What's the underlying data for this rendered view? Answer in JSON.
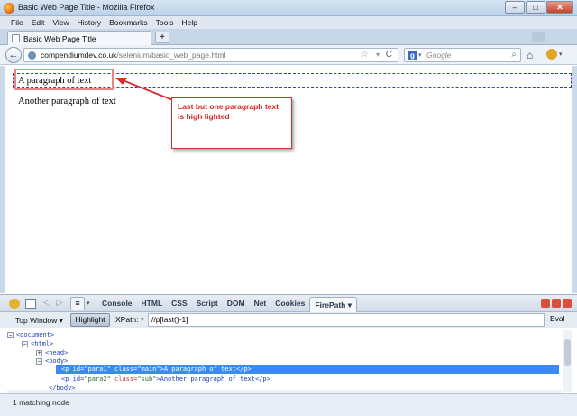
{
  "window": {
    "title": "Basic Web Page Title - Mozilla Firefox",
    "min_glyph": "–",
    "max_glyph": "□",
    "close_glyph": "✕"
  },
  "menu": [
    "File",
    "Edit",
    "View",
    "History",
    "Bookmarks",
    "Tools",
    "Help"
  ],
  "tab": {
    "label": "Basic Web Page Title",
    "new_tab_glyph": "+"
  },
  "nav": {
    "back_glyph": "←",
    "url_host": "compendiumdev.co.uk",
    "url_path": "/selenium/basic_web_page.html",
    "star_glyph": "☆",
    "drop_glyph": "▾",
    "reload_glyph": "C",
    "search_engine_glyph": "g",
    "search_placeholder": "Google",
    "search_glyph": "⌕",
    "home_glyph": "⌂"
  },
  "page": {
    "paragraph1": "A paragraph of text",
    "paragraph2": "Another paragraph of text",
    "annotation": "Last but one paragraph text is high lighted"
  },
  "firebug": {
    "menu_glyph": "≡",
    "back_glyph": "◁",
    "forward_glyph": "▷",
    "tabs": [
      "Console",
      "HTML",
      "CSS",
      "Script",
      "DOM",
      "Net",
      "Cookies",
      "FirePath ▾"
    ],
    "active_tab": "FirePath ▾",
    "top_window": "Top Window ▾",
    "highlight_label": "Highlight",
    "xpath_label": "XPath:",
    "xpath_value": "//p[last()-1]",
    "eval_label": "Eval",
    "tree": {
      "document": "<document>",
      "html": "<html>",
      "head": "<head>",
      "body": "<body>",
      "p1_tag_open": "<p id=",
      "p1_id": "\"para1\"",
      "p1_class_attr": " class=",
      "p1_class": "\"main\"",
      "p1_text": ">A paragraph of text</p>",
      "p2_tag_open": "<p id=",
      "p2_id": "\"para2\"",
      "p2_class_attr": " class=",
      "p2_class": "\"sub\"",
      "p2_text": ">Another paragraph of text</p>",
      "body_close": "</body>"
    },
    "status": "1 matching node"
  },
  "colors": {
    "annotation_red": "#e02020",
    "highlight_outline": "#2b3ce0",
    "selection_blue": "#3b8af0"
  }
}
